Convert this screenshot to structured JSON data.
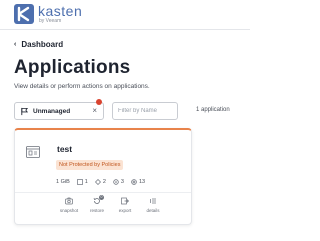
{
  "logo": {
    "name": "kasten",
    "sub": "by Veeam"
  },
  "breadcrumb": {
    "label": "Dashboard"
  },
  "page": {
    "title": "Applications",
    "description": "View details or perform actions on applications."
  },
  "filter": {
    "chip_label": "Unmanaged",
    "search_placeholder": "Filter by Name"
  },
  "result_count": "1 application",
  "app": {
    "name": "test",
    "status": "Not Protected by Policies",
    "stats": {
      "size": "1 GiB",
      "storage": "1",
      "workloads": "2",
      "resources": "3",
      "config": "13"
    },
    "actions": [
      {
        "label": "snapshot"
      },
      {
        "label": "restore",
        "count": "0"
      },
      {
        "label": "export"
      },
      {
        "label": "details"
      }
    ]
  },
  "colors": {
    "brand": "#4d6fae",
    "accent_orange": "#e8834a",
    "alert_red": "#d9432f"
  }
}
